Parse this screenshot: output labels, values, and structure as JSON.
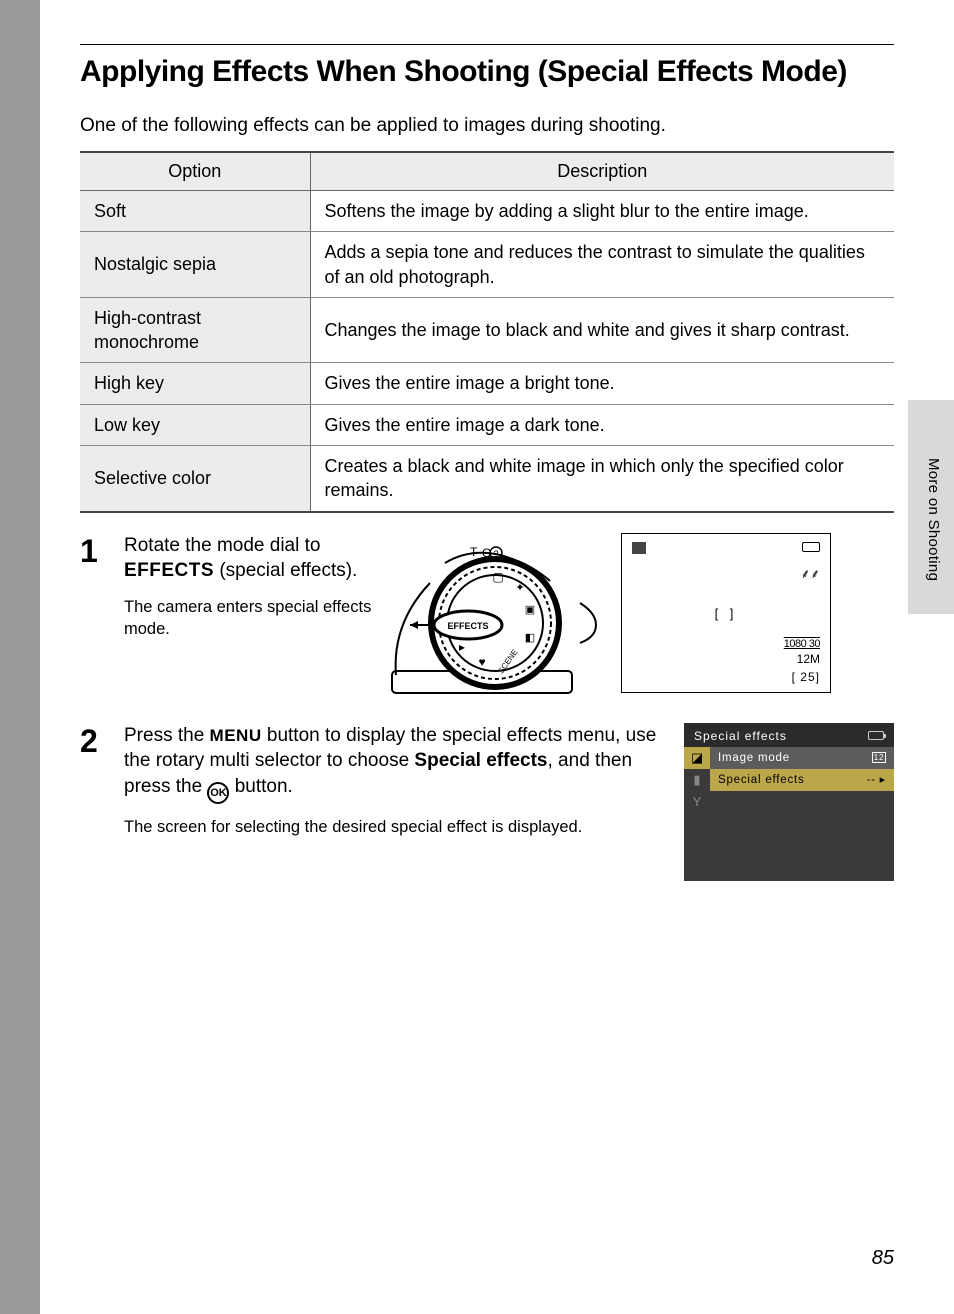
{
  "title": "Applying Effects When Shooting (Special Effects Mode)",
  "intro": "One of the following effects can be applied to images during shooting.",
  "table": {
    "headers": {
      "option": "Option",
      "description": "Description"
    },
    "rows": [
      {
        "option": "Soft",
        "description": "Softens the image by adding a slight blur to the entire image."
      },
      {
        "option": "Nostalgic sepia",
        "description": "Adds a sepia tone and reduces the contrast to simulate the qualities of an old photograph."
      },
      {
        "option": "High-contrast monochrome",
        "description": "Changes the image to black and white and gives it sharp contrast."
      },
      {
        "option": "High key",
        "description": "Gives the entire image a bright tone."
      },
      {
        "option": "Low key",
        "description": "Gives the entire image a dark tone."
      },
      {
        "option": "Selective color",
        "description": "Creates a black and white image in which only the specified color remains."
      }
    ]
  },
  "step1": {
    "num": "1",
    "line_a": "Rotate the mode dial to ",
    "effects_word": "EFFECTS",
    "line_b": " (special effects).",
    "sub": "The camera enters special effects mode.",
    "dial_label": "EFFECTS",
    "dial_marks": {
      "t": "T",
      "q": "Q",
      "help": "?",
      "scene": "SCENE"
    },
    "lcd": {
      "af_palm": "⸙⸙",
      "brackets": "[    ]",
      "rec": "1080 30",
      "qual": "12M",
      "remain": "[   25]"
    }
  },
  "step2": {
    "num": "2",
    "line_a": "Press the ",
    "menu_word": "MENU",
    "line_b": " button to display the special effects menu, use the rotary multi selector to choose ",
    "bold": "Special effects",
    "line_c": ", and then press the ",
    "ok": "OK",
    "line_d": " button.",
    "sub": "The screen for selecting the desired special effect is displayed.",
    "menu": {
      "title": "Special effects",
      "image_mode": "Image mode",
      "special_effects": "Special effects",
      "se_value": "--",
      "arrow": "▸"
    }
  },
  "side_tab": "More on Shooting",
  "page_number": "85"
}
